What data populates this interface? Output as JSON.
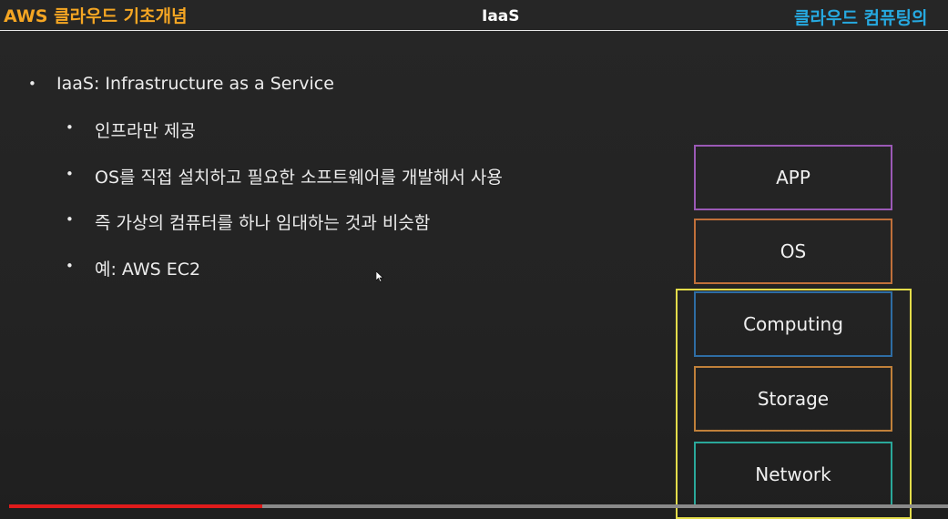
{
  "header": {
    "left_title": "AWS 클라우드 기초개념",
    "center_title": "IaaS",
    "right_title": "클라우드 컴퓨팅의"
  },
  "bullets": {
    "main": "IaaS: Infrastructure as a Service",
    "sub": [
      "인프라만 제공",
      "OS를 직접 설치하고 필요한 소프트웨어를 개발해서 사용",
      "즉 가상의 컴퓨터를 하나 임대하는 것과 비슷함",
      "예: AWS EC2"
    ],
    "marker": "•"
  },
  "stack": {
    "layers": [
      {
        "label": "APP",
        "color": "#9b59b6"
      },
      {
        "label": "OS",
        "color": "#c0703a"
      },
      {
        "label": "Computing",
        "color": "#2e6da4"
      },
      {
        "label": "Storage",
        "color": "#c0803a"
      },
      {
        "label": "Network",
        "color": "#2aa89a"
      }
    ],
    "iaas_frame_color": "#e3dc4a"
  },
  "video": {
    "progress_fraction": 0.27,
    "progress_color": "#e01b1b"
  }
}
